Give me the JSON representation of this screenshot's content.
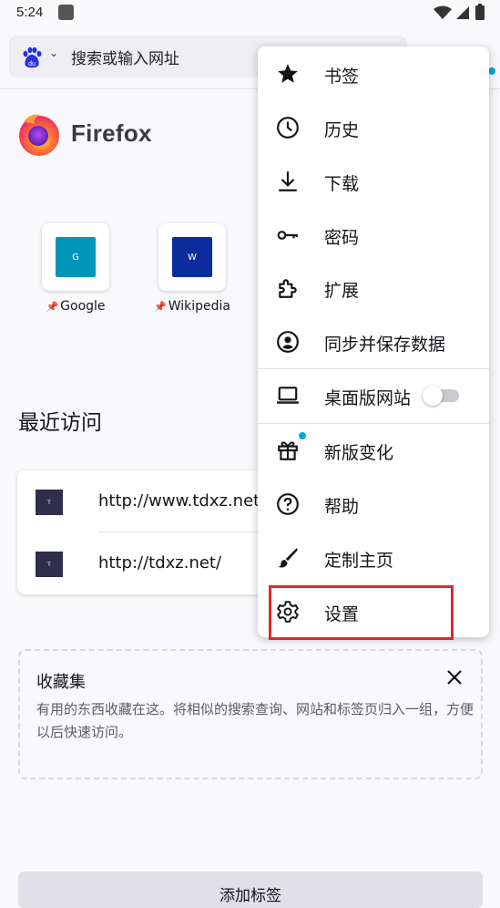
{
  "status_bar": {
    "time": "5:24"
  },
  "toolbar": {
    "url_placeholder": "搜索或输入网址",
    "search_engine_icon": "baidu-icon"
  },
  "home": {
    "wordmark": "Firefox"
  },
  "top_sites": [
    {
      "label": "Google",
      "letter": "G",
      "color": "#0096b8"
    },
    {
      "label": "Wikipedia",
      "letter": "W",
      "color": "#0b2c9c"
    }
  ],
  "recent": {
    "title": "最近访问",
    "items": [
      {
        "url": "http://www.tdxz.net/",
        "letter": "T"
      },
      {
        "url": "http://tdxz.net/",
        "letter": "T"
      }
    ]
  },
  "collections": {
    "title": "收藏集",
    "description": "有用的东西收藏在这。将相似的搜索查询、网站和标签页归入一组，方便以后快速访问。"
  },
  "bottom_button": {
    "label": "添加标签"
  },
  "menu": {
    "items": [
      {
        "label": "书签",
        "icon": "star-icon"
      },
      {
        "label": "历史",
        "icon": "clock-icon"
      },
      {
        "label": "下载",
        "icon": "download-icon"
      },
      {
        "label": "密码",
        "icon": "key-icon"
      },
      {
        "label": "扩展",
        "icon": "puzzle-icon"
      },
      {
        "label": "同步并保存数据",
        "icon": "account-icon"
      },
      {
        "label": "桌面版网站",
        "icon": "laptop-icon",
        "toggle_on": false
      },
      {
        "label": "新版变化",
        "icon": "gift-icon"
      },
      {
        "label": "帮助",
        "icon": "help-icon"
      },
      {
        "label": "定制主页",
        "icon": "brush-icon"
      },
      {
        "label": "设置",
        "icon": "gear-icon"
      }
    ],
    "highlighted_item": "设置",
    "highlight_color": "#e0282a"
  },
  "colors": {
    "accent_dot": "#00a9e0"
  }
}
